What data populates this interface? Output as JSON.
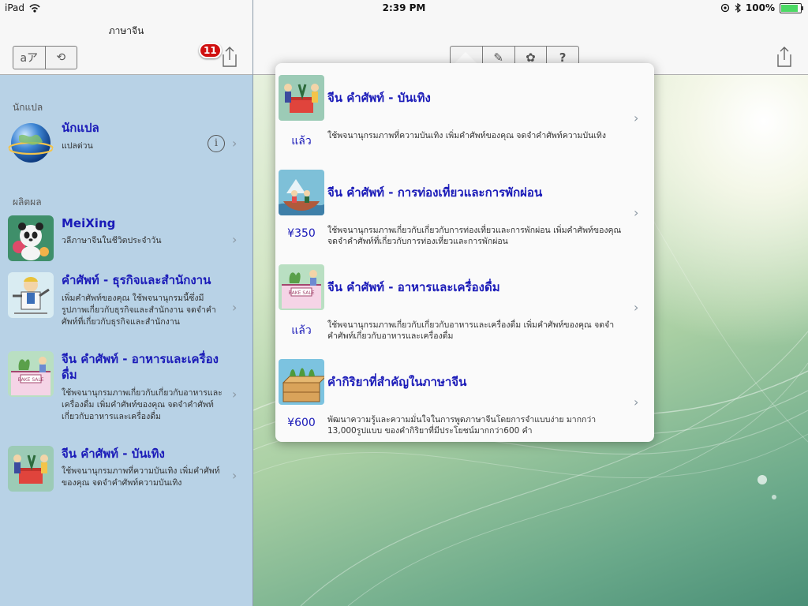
{
  "status_bar": {
    "device": "iPad",
    "time": "2:39 PM",
    "battery": "100%"
  },
  "left_nav": {
    "title": "ภาษาจีน",
    "seg_translate": "aア",
    "seg_refresh": "⟲",
    "badge": "11"
  },
  "left_sections": [
    {
      "header": "นักแปล",
      "items": [
        {
          "title": "นักแปล",
          "subtitle": "แปลด่วน",
          "info": "i"
        }
      ]
    },
    {
      "header": "ผลิตผล",
      "items": [
        {
          "title": "MeiXing",
          "subtitle": "วลีภาษาจีนในชีวิตประจำวัน"
        },
        {
          "title": "คำศัพท์ - ธุรกิจและสำนักงาน",
          "subtitle": "เพิ่มคำศัพท์ของคุณ ใช้พจนานุกรมนี้ซึ่งมีรูปภาพเกี่ยวกับธุรกิจและสำนักงาน จดจำคำศัพท์ที่เกี่ยวกับธุรกิจและสำนักงาน"
        },
        {
          "title": "จีน คำศัพท์ - อาหารและเครื่องดื่ม",
          "subtitle": "ใช้พจนานุกรมภาพเกี่ยวกับเกี่ยวกับอาหารและเครื่องดื่ม เพิ่มคำศัพท์ของคุณ จดจำคำศัพท์เกี่ยวกับอาหารและเครื่องดื่ม"
        },
        {
          "title": "จีน คำศัพท์ - บันเทิง",
          "subtitle": "ใช้พจนานุกรมภาพที่ความบันเทิง เพิ่มคำศัพท์ของคุณ จดจำคำศัพท์ความบันเทิง"
        }
      ]
    }
  ],
  "toolbar": {
    "buttons": [
      "⌂",
      "✎",
      "✿",
      "?"
    ]
  },
  "popover": {
    "items": [
      {
        "title": "จีน คำศัพท์ - บันเทิง",
        "price": "แล้ว",
        "subtitle": "ใช้พจนานุกรมภาพที่ความบันเทิง เพิ่มคำศัพท์ของคุณ จดจำคำศัพท์ความบันเทิง"
      },
      {
        "title": "จีน คำศัพท์ - การท่องเที่ยวและการพักผ่อน",
        "price": "¥350",
        "subtitle": "ใช้พจนานุกรมภาพเกี่ยวกับเกี่ยวกับการท่องเที่ยวและการพักผ่อน เพิ่มคำศัพท์ของคุณ จดจำคำศัพท์ที่เกี่ยวกับการท่องเที่ยวและการพักผ่อน"
      },
      {
        "title": "จีน คำศัพท์ - อาหารและเครื่องดื่ม",
        "price": "แล้ว",
        "subtitle": "ใช้พจนานุกรมภาพเกี่ยวกับเกี่ยวกับอาหารและเครื่องดื่ม เพิ่มคำศัพท์ของคุณ จดจำคำศัพท์เกี่ยวกับอาหารและเครื่องดื่ม"
      },
      {
        "title": "คำกิริยาที่สำคัญในภาษาจีน",
        "price": "¥600",
        "subtitle": "พัฒนาความรู้และความมั่นใจในการพูดภาษาจีนโดยการจำแบบง่าย มากกว่า 13,000รูปแบบ ของคำกิริยาที่มีประโยชน์มากกว่า600 คำ"
      }
    ]
  },
  "colors": {
    "accent": "#1a1ab8",
    "left_bg": "#b8d2e6",
    "badge": "#d01010"
  },
  "icons": {
    "chevron": "›"
  }
}
